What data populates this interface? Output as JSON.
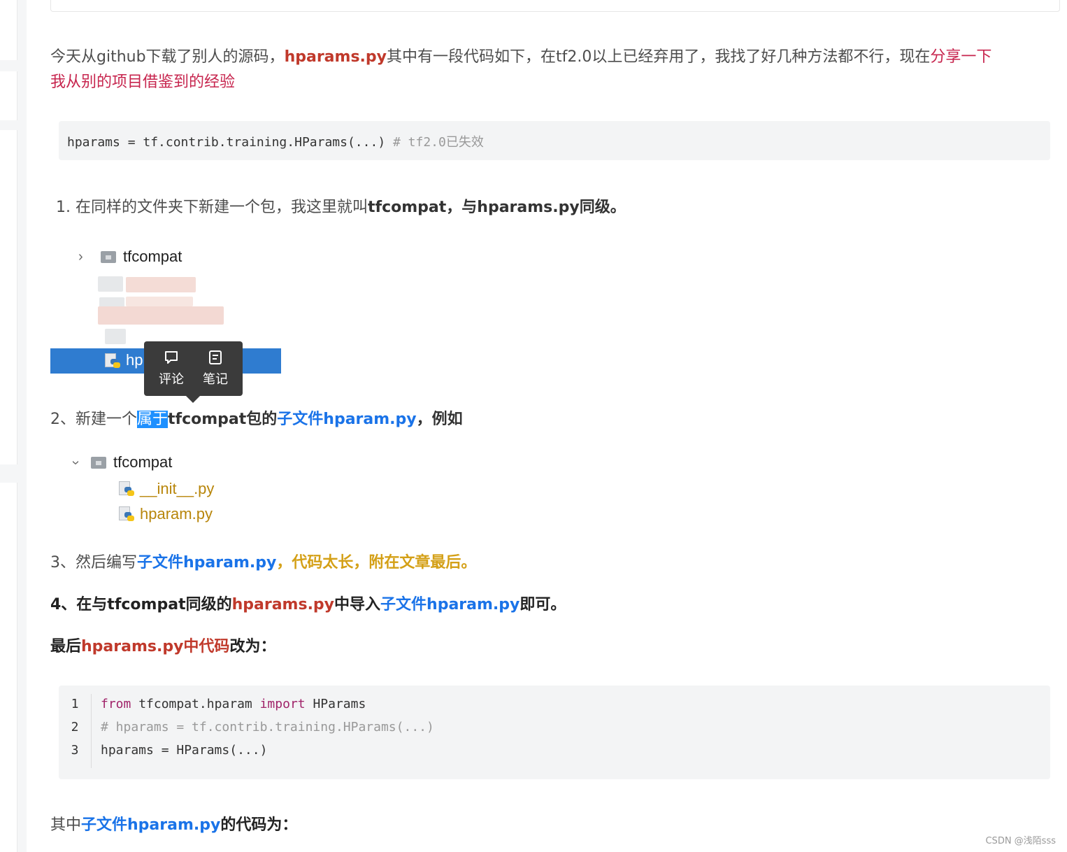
{
  "intro": {
    "text1": "今天从github下载了别人的源码，",
    "file": "hparams.py",
    "text2": "其中有一段代码如下，在tf2.0以上已经弃用了，我找了好几种方法都不行，现在",
    "highlight": "分享一下",
    "line2": "我从别的项目借鉴到的经验"
  },
  "code1": {
    "code": "hparams = tf.contrib.training.HParams(...)",
    "comment": "# tf2.0已失效"
  },
  "step1": {
    "text": "1. 在同样的文件夹下新建一个包，我这里就叫",
    "bold": "tfcompat，与hparams.py同级。"
  },
  "tree1": {
    "folder": "tfcompat",
    "selected_partial": "hp"
  },
  "tooltip": {
    "comment": "评论",
    "note": "笔记"
  },
  "step2": {
    "prefix": "2、新建一个",
    "selected": "属于",
    "bold1": "tfcompat包的",
    "blue": "子文件hparam.py",
    "bold2": "，例如"
  },
  "tree2": {
    "folder": "tfcompat",
    "file1": "__init__.py",
    "file2": "hparam.py"
  },
  "step3": {
    "prefix": "3、然后编写",
    "blue": "子文件hparam.py",
    "gold": "，代码太长，附在文章最后。"
  },
  "step4": {
    "prefix": "4、在与tfcompat同级的",
    "red": "hparams.py",
    "mid": "中导入",
    "blue": "子文件hparam.py",
    "suffix": "即可。"
  },
  "final": {
    "prefix": "最后",
    "red": "hparams.py中代码",
    "suffix": "改为："
  },
  "code2": {
    "lines": [
      {
        "num": "1",
        "kw1": "from",
        "a": " tfcompat.hparam ",
        "kw2": "import",
        "b": " HParams"
      },
      {
        "num": "2",
        "comment": "# hparams = tf.contrib.training.HParams(...)"
      },
      {
        "num": "3",
        "plain": "hparams = HParams(...)"
      }
    ]
  },
  "last": {
    "prefix": "其中",
    "blue": "子文件hparam.py",
    "suffix": "的代码为："
  },
  "watermark": "CSDN @浅陌sss"
}
